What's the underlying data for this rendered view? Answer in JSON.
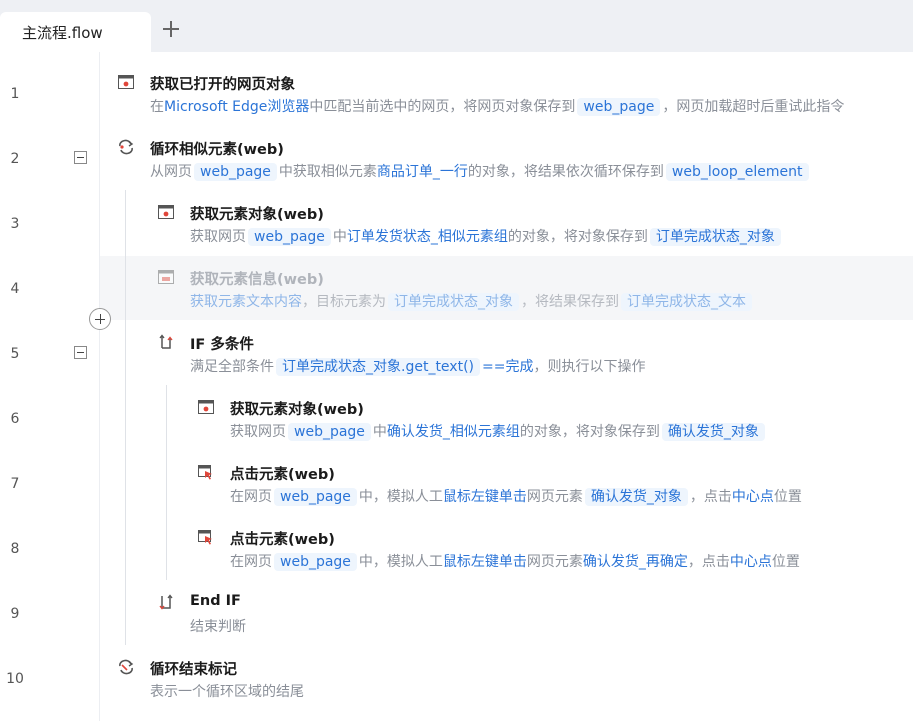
{
  "tab": {
    "title": "主流程.flow",
    "add_icon": "plus-icon"
  },
  "line_numbers": [
    "1",
    "2",
    "3",
    "4",
    "5",
    "6",
    "7",
    "8",
    "9",
    "10"
  ],
  "steps": [
    {
      "icon": "browser-window-icon",
      "title": "获取已打开的网页对象",
      "desc": [
        {
          "t": "在"
        },
        {
          "k": "Microsoft Edge浏览器"
        },
        {
          "t": "中匹配当前选中的网页，将网页对象保存到"
        },
        {
          "c": "web_page"
        },
        {
          "t": "，网页加载超时后重试此指令"
        }
      ]
    },
    {
      "icon": "loop-icon",
      "title": "循环相似元素(web)",
      "desc": [
        {
          "t": "从网页"
        },
        {
          "c": "web_page"
        },
        {
          "t": "中获取相似元素"
        },
        {
          "k": "商品订单_一行"
        },
        {
          "t": "的对象，将结果依次循环保存到"
        },
        {
          "c": "web_loop_element"
        }
      ]
    },
    {
      "icon": "browser-window-icon",
      "title": "获取元素对象(web)",
      "desc": [
        {
          "t": "获取网页"
        },
        {
          "c": "web_page"
        },
        {
          "t": "中"
        },
        {
          "k": "订单发货状态_相似元素组"
        },
        {
          "t": "的对象，将对象保存到"
        },
        {
          "c": "订单完成状态_对象"
        }
      ]
    },
    {
      "icon": "element-info-icon",
      "title": "获取元素信息(web)",
      "desc": [
        {
          "k": "获取元素文本内容"
        },
        {
          "t": "，目标元素为"
        },
        {
          "c": "订单完成状态_对象"
        },
        {
          "t": "，将结果保存到"
        },
        {
          "c": "订单完成状态_文本"
        }
      ]
    },
    {
      "icon": "if-branch-icon",
      "title": "IF 多条件",
      "desc": [
        {
          "t": "满足全部条件"
        },
        {
          "c": "订单完成状态_对象.get_text()"
        },
        {
          "k": "==完成"
        },
        {
          "t": "，则执行以下操作"
        }
      ]
    },
    {
      "icon": "browser-window-icon",
      "title": "获取元素对象(web)",
      "desc": [
        {
          "t": "获取网页"
        },
        {
          "c": "web_page"
        },
        {
          "t": "中"
        },
        {
          "k": "确认发货_相似元素组"
        },
        {
          "t": "的对象，将对象保存到"
        },
        {
          "c": "确认发货_对象"
        }
      ]
    },
    {
      "icon": "click-icon",
      "title": "点击元素(web)",
      "desc": [
        {
          "t": "在网页"
        },
        {
          "c": "web_page"
        },
        {
          "t": "中，模拟人工"
        },
        {
          "k": "鼠标左键单击"
        },
        {
          "t": "网页元素"
        },
        {
          "c": "确认发货_对象"
        },
        {
          "t": "，点击"
        },
        {
          "k": "中心点"
        },
        {
          "t": "位置"
        }
      ]
    },
    {
      "icon": "click-icon",
      "title": "点击元素(web)",
      "desc": [
        {
          "t": "在网页"
        },
        {
          "c": "web_page"
        },
        {
          "t": "中，模拟人工"
        },
        {
          "k": "鼠标左键单击"
        },
        {
          "t": "网页元素"
        },
        {
          "k": "确认发货_再确定"
        },
        {
          "t": "，点击"
        },
        {
          "k": "中心点"
        },
        {
          "t": "位置"
        }
      ]
    },
    {
      "icon": "end-if-icon",
      "title": "End IF",
      "desc": [
        {
          "t": "结束判断"
        }
      ]
    },
    {
      "icon": "loop-end-icon",
      "title": "循环结束标记",
      "desc": [
        {
          "t": "表示一个循环区域的结尾"
        }
      ]
    }
  ],
  "colors": {
    "keyword": "#2b74d7",
    "chip_bg": "#eef5fd",
    "muted": "#8a8f98"
  }
}
